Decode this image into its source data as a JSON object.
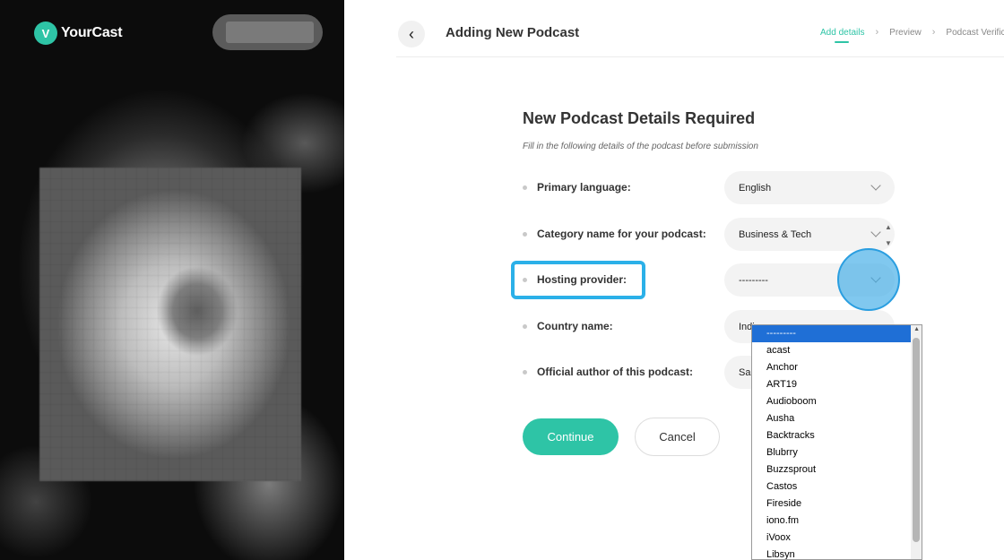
{
  "brand": {
    "name": "YourCast",
    "logo_icon": "podcast-v-icon",
    "accent": "#2ec4a6"
  },
  "header": {
    "back_icon": "chevron-left-icon",
    "title": "Adding New Podcast",
    "steps": [
      "Add details",
      "Preview",
      "Podcast Verifica"
    ],
    "active_step": "Add details"
  },
  "form": {
    "title": "New Podcast Details Required",
    "subtitle": "Fill in the following details of the podcast before submission",
    "fields": [
      {
        "label": "Primary language:",
        "value": "English"
      },
      {
        "label": "Category name for your podcast:",
        "value": "Business & Tech"
      },
      {
        "label": "Hosting provider:",
        "value": "---------"
      },
      {
        "label": "Country name:",
        "value": "Indi"
      },
      {
        "label": "Official author of this podcast:",
        "value": "Sa"
      }
    ],
    "continue_label": "Continue",
    "cancel_label": "Cancel"
  },
  "hosting_dropdown": {
    "options": [
      "---------",
      "acast",
      "Anchor",
      "ART19",
      "Audioboom",
      "Ausha",
      "Backtracks",
      "Blubrry",
      "Buzzsprout",
      "Castos",
      "Fireside",
      "iono.fm",
      "iVoox",
      "Libsyn"
    ],
    "selected_index": 0,
    "highlight_color": "#1f6fd6"
  },
  "annotations": {
    "highlight_color": "#2bb0e8"
  }
}
